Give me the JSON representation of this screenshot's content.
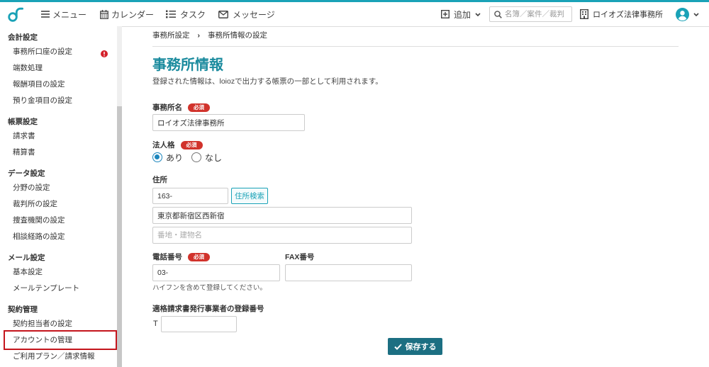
{
  "colors": {
    "accent": "#1aa2b7",
    "title": "#1b8b9e",
    "radio": "#1d86bd",
    "save_button": "#1c6f82",
    "required_badge": "#d1332c",
    "highlight_border": "#c4151c",
    "alert": "#d4202a"
  },
  "header": {
    "logo_icon": "loioz-logo-icon",
    "nav": [
      {
        "icon": "hamburger-icon",
        "label": "メニュー"
      },
      {
        "icon": "calendar-icon",
        "label": "カレンダー"
      },
      {
        "icon": "list-icon",
        "label": "タスク"
      },
      {
        "icon": "envelope-icon",
        "label": "メッセージ"
      }
    ],
    "add": {
      "icon": "plus-square-icon",
      "label": "追加"
    },
    "search": {
      "icon": "search-icon",
      "placeholder": "名簿／案件／裁判"
    },
    "office": {
      "icon": "building-icon",
      "name": "ロイオズ法律事務所"
    },
    "user": {
      "icon": "user-avatar-icon"
    }
  },
  "sidebar": {
    "sections": [
      {
        "heading": "会計設定",
        "items": [
          {
            "label": "事務所口座の設定",
            "alert": true
          },
          {
            "label": "端数処理"
          },
          {
            "label": "報酬項目の設定"
          },
          {
            "label": "預り金項目の設定"
          }
        ]
      },
      {
        "heading": "帳票設定",
        "items": [
          {
            "label": "請求書"
          },
          {
            "label": "精算書"
          }
        ]
      },
      {
        "heading": "データ設定",
        "items": [
          {
            "label": "分野の設定"
          },
          {
            "label": "裁判所の設定"
          },
          {
            "label": "捜査機関の設定"
          },
          {
            "label": "相談経路の設定"
          }
        ]
      },
      {
        "heading": "メール設定",
        "items": [
          {
            "label": "基本設定"
          },
          {
            "label": "メールテンプレート"
          }
        ]
      },
      {
        "heading": "契約管理",
        "items": [
          {
            "label": "契約担当者の設定"
          },
          {
            "label": "アカウントの管理",
            "highlighted": true
          },
          {
            "label": "ご利用プラン／請求情報"
          }
        ]
      }
    ]
  },
  "breadcrumb": {
    "items": [
      "事務所設定",
      "事務所情報の設定"
    ],
    "separator": "›"
  },
  "page": {
    "title": "事務所情報",
    "description": "登録された情報は、loiozで出力する帳票の一部として利用されます。"
  },
  "form": {
    "required_badge": "必須",
    "office_name": {
      "label": "事務所名",
      "value": "ロイオズ法律事務所"
    },
    "corporate_status": {
      "label": "法人格",
      "options": [
        "あり",
        "なし"
      ],
      "selected_index": 0
    },
    "address": {
      "label": "住所",
      "postal_code": "163-",
      "search_button": "住所検索",
      "line1": "東京都新宿区西新宿",
      "line2": "",
      "line2_placeholder": "番地・建物名"
    },
    "phone": {
      "label": "電話番号",
      "value": "03-",
      "hint": "ハイフンを含めて登録してください。"
    },
    "fax": {
      "label": "FAX番号",
      "value": ""
    },
    "invoice_registration": {
      "label": "適格請求書発行事業者の登録番号",
      "prefix": "T",
      "value": ""
    },
    "save_label": "保存する"
  }
}
